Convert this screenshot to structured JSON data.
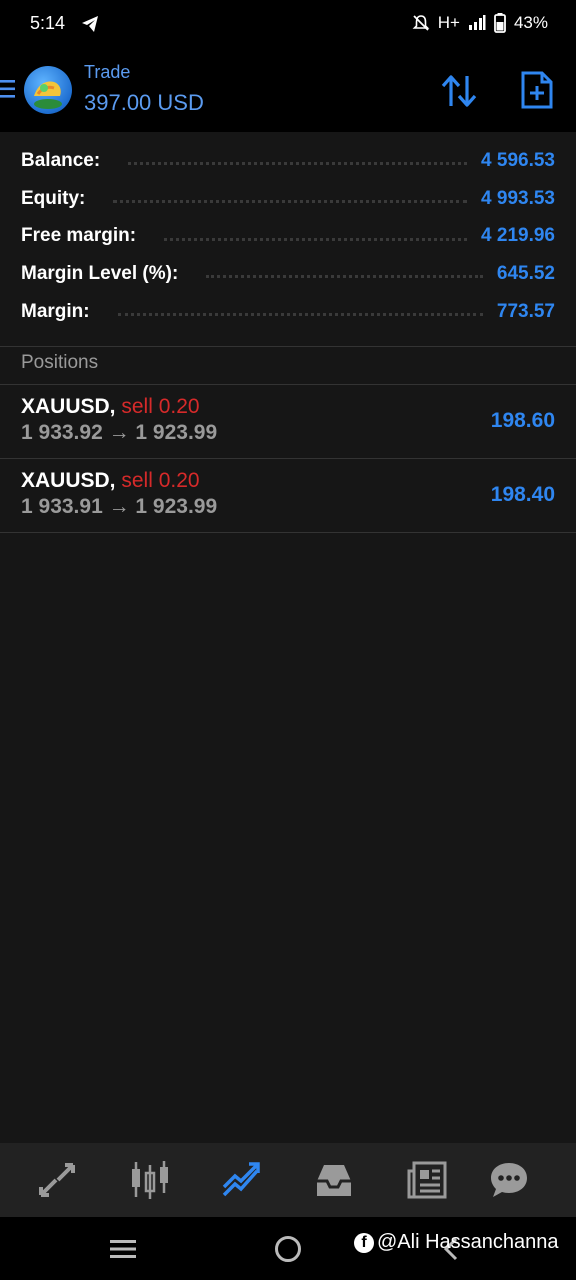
{
  "status_bar": {
    "time": "5:14",
    "network": "H+",
    "battery": "43%",
    "icons": [
      "telegram-icon",
      "bell-off-icon",
      "signal-icon",
      "battery-icon"
    ]
  },
  "header": {
    "title": "Trade",
    "value": "397.00 USD",
    "icons": [
      "menu-icon",
      "sort-icon",
      "new-order-icon"
    ]
  },
  "summary": [
    {
      "label": "Balance:",
      "value": "4 596.53"
    },
    {
      "label": "Equity:",
      "value": "4 993.53"
    },
    {
      "label": "Free margin:",
      "value": "4 219.96"
    },
    {
      "label": "Margin Level (%):",
      "value": "645.52"
    },
    {
      "label": "Margin:",
      "value": "773.57"
    }
  ],
  "positions": {
    "header": "Positions",
    "items": [
      {
        "symbol": "XAUUSD,",
        "side": "sell 0.20",
        "price_line": "1 933.92 → 1 923.99",
        "profit": "198.60"
      },
      {
        "symbol": "XAUUSD,",
        "side": "sell 0.20",
        "price_line": "1 933.91 → 1 923.99",
        "profit": "198.40"
      }
    ]
  },
  "bottom_nav": {
    "items": [
      "quotes-icon",
      "chart-icon",
      "trade-icon",
      "history-icon",
      "news-icon",
      "chat-icon"
    ],
    "active": "trade-icon"
  },
  "watermark": {
    "text": "@Ali Hassanchanna",
    "icon": "facebook-icon"
  },
  "colors": {
    "accent": "#2f86f0",
    "sell": "#d62a2a",
    "background": "#161616"
  }
}
